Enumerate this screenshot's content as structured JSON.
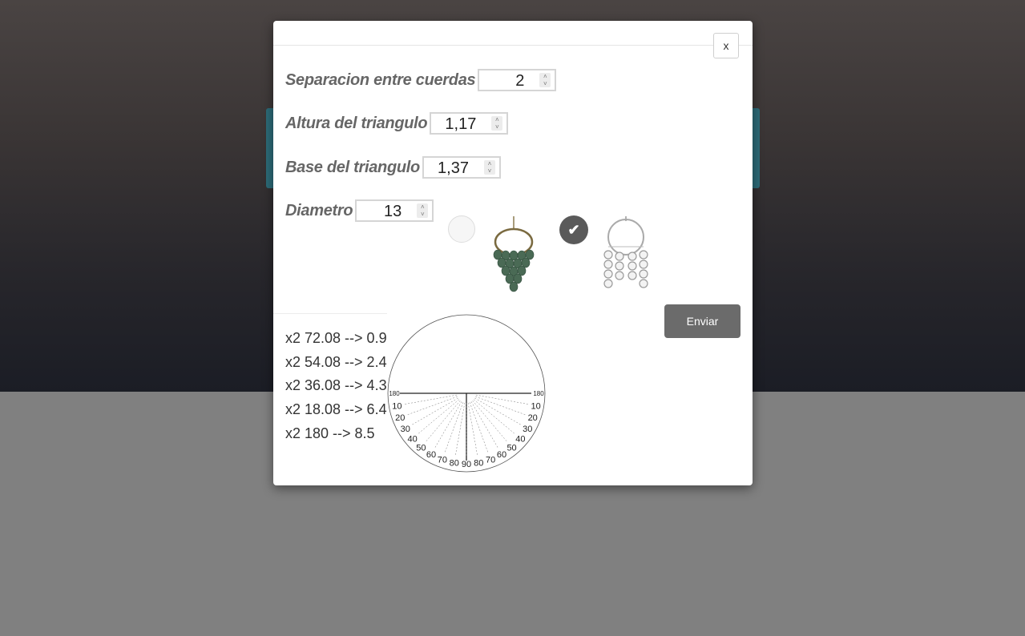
{
  "modal": {
    "close_label": "x",
    "fields": [
      {
        "label": "Separacion entre cuerdas",
        "value": "2"
      },
      {
        "label": "Altura del triangulo",
        "value": "1,17"
      },
      {
        "label": "Base del triangulo",
        "value": "1,37"
      },
      {
        "label": "Diametro",
        "value": "13"
      }
    ],
    "options": [
      {
        "name": "green-leaf-earring",
        "selected": false
      },
      {
        "name": "silver-hoop-earring",
        "selected": true
      }
    ],
    "submit_label": "Enviar",
    "results": [
      "x2 72.08 --> 0.9",
      "x2 54.08 --> 2.4",
      "x2 36.08 --> 4.3",
      "x2 18.08 --> 6.4",
      "x2 180 --> 8.5"
    ],
    "protractor": {
      "edge_label": "180",
      "left_labels": [
        "10",
        "20",
        "30",
        "40",
        "50",
        "60",
        "70",
        "80"
      ],
      "center_label": "90",
      "right_labels": [
        "80",
        "70",
        "60",
        "50",
        "40",
        "30",
        "20",
        "10"
      ]
    }
  }
}
